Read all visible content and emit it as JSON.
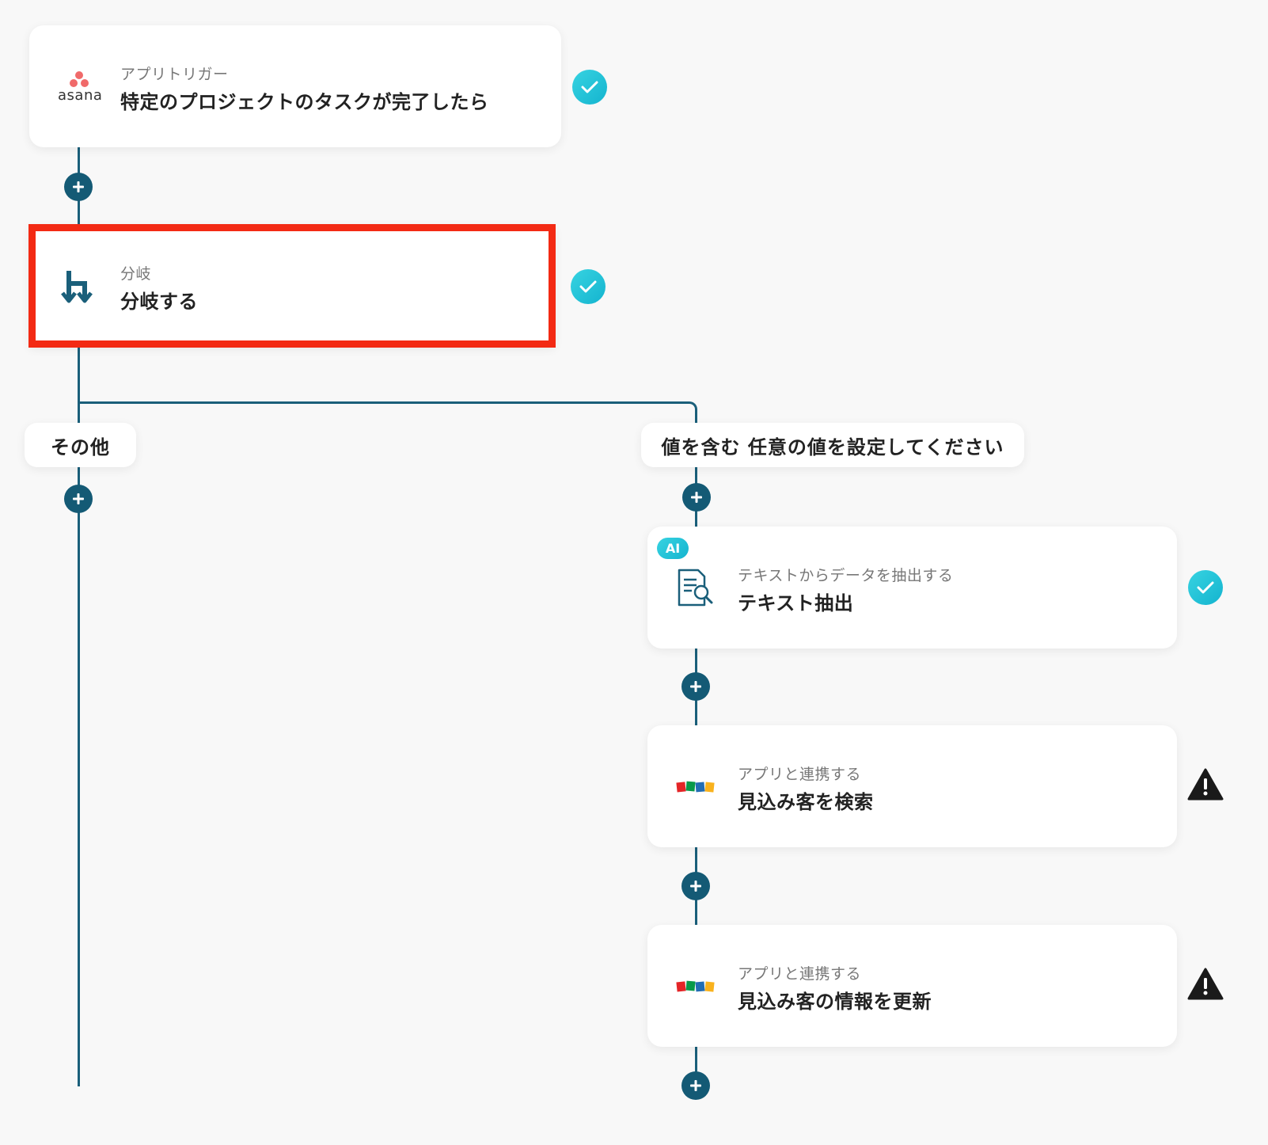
{
  "trigger": {
    "app_name": "asana",
    "sub_label": "アプリトリガー",
    "title": "特定のプロジェクトのタスクが完了したら",
    "status": "complete"
  },
  "branch": {
    "sub_label": "分岐",
    "title": "分岐する",
    "status": "complete"
  },
  "branch_paths": {
    "left_label": "その他",
    "right_label": "値を含む 任意の値を設定してください"
  },
  "steps": [
    {
      "badge": "AI",
      "sub_label": "テキストからデータを抽出する",
      "title": "テキスト抽出",
      "status": "complete"
    },
    {
      "app_name": "ZOHO",
      "sub_label": "アプリと連携する",
      "title": "見込み客を検索",
      "status": "warning"
    },
    {
      "app_name": "ZOHO",
      "sub_label": "アプリと連携する",
      "title": "見込み客の情報を更新",
      "status": "warning"
    }
  ],
  "colors": {
    "connector": "#1a5f7a",
    "plus_button": "#145a75",
    "check": "#14b4cf",
    "highlight": "#f32a14",
    "asana": "#f06a6a"
  }
}
